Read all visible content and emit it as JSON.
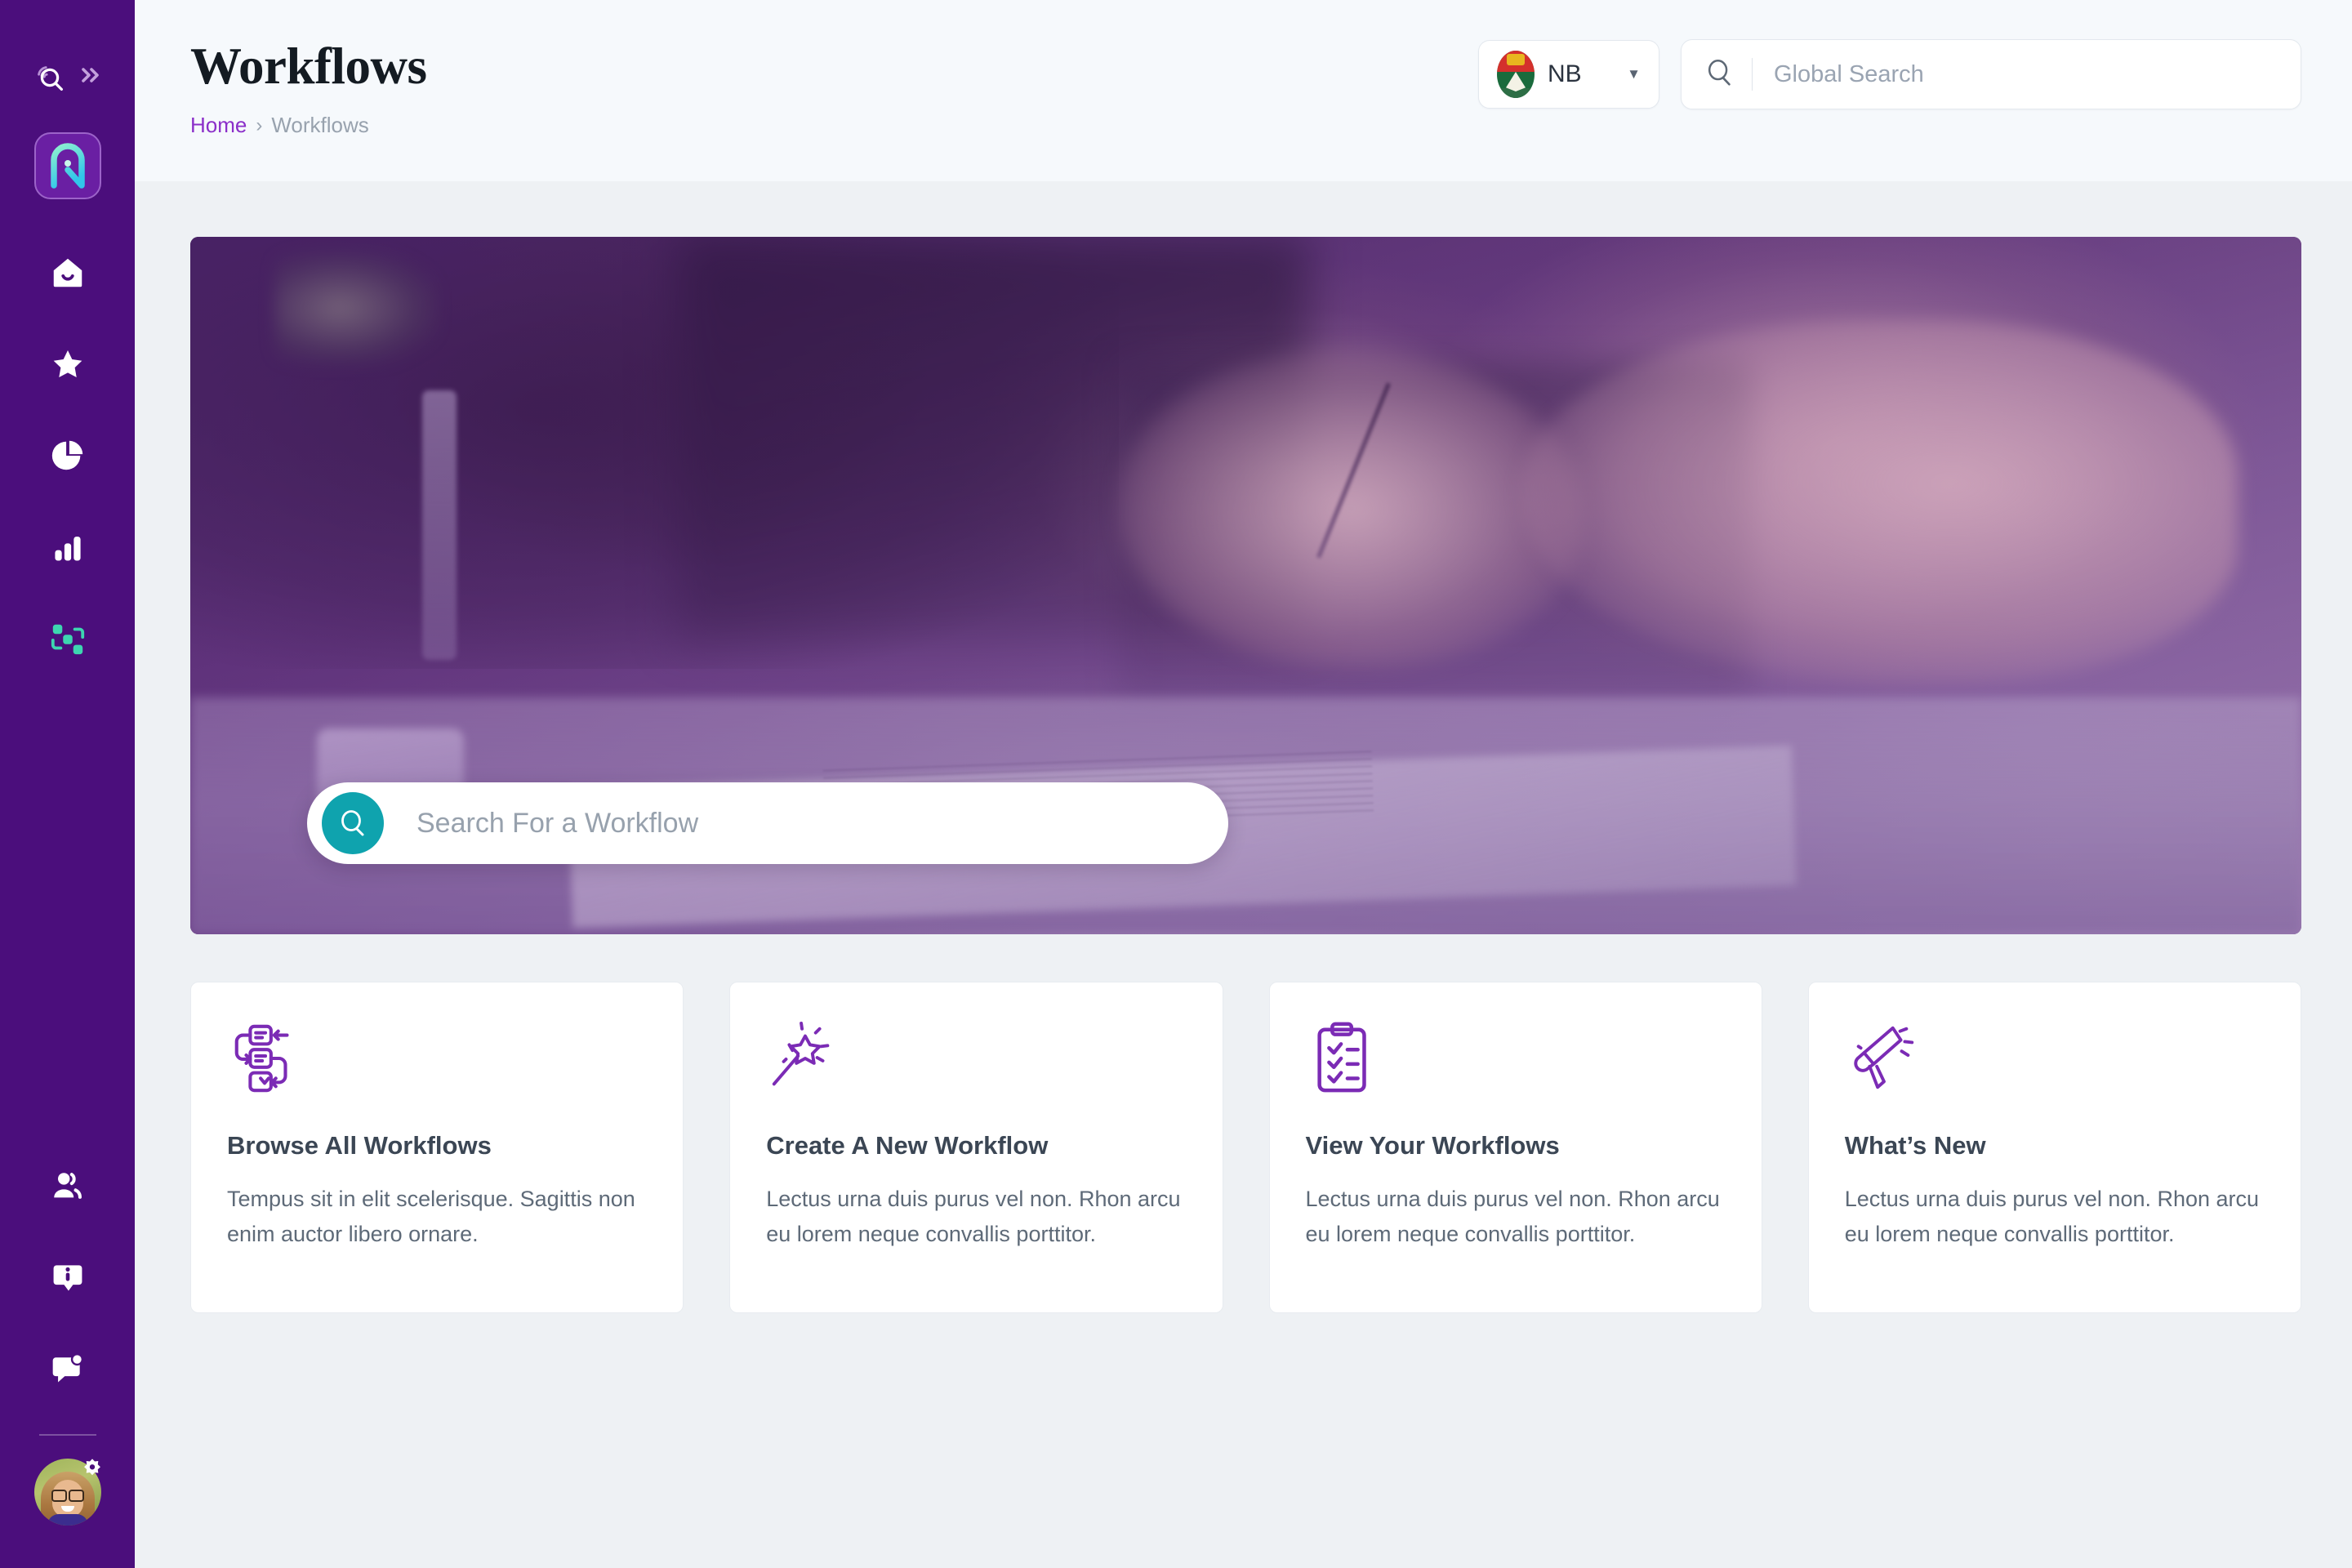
{
  "sidebar": {
    "search_icon": "search-signal-icon",
    "expand_icon": "double-chevron-right-icon",
    "logo_icon": "app-logo-icon",
    "items": [
      {
        "name": "home",
        "icon": "home-icon",
        "active": false
      },
      {
        "name": "favorites",
        "icon": "star-icon",
        "active": false
      },
      {
        "name": "reports",
        "icon": "pie-chart-icon",
        "active": false
      },
      {
        "name": "analytics",
        "icon": "bar-chart-icon",
        "active": false
      },
      {
        "name": "workflows",
        "icon": "workflow-nodes-icon",
        "active": true
      }
    ],
    "bottom_items": [
      {
        "name": "users",
        "icon": "users-icon"
      },
      {
        "name": "information",
        "icon": "info-bubble-icon"
      },
      {
        "name": "messages",
        "icon": "chat-bubble-icon"
      }
    ],
    "avatar": {
      "name": "user-avatar",
      "badge_icon": "gear-icon"
    },
    "background_color": "#4B0E7C",
    "accent_color": "#3DD6B0"
  },
  "header": {
    "title": "Workflows",
    "breadcrumb": {
      "home": "Home",
      "separator": "›",
      "current": "Workflows"
    },
    "region": {
      "code": "NB",
      "flag_icon": "new-brunswick-flag-icon",
      "caret_icon": "chevron-down-icon"
    },
    "global_search": {
      "placeholder": "Global Search",
      "value": "",
      "icon": "search-icon"
    }
  },
  "hero": {
    "image_alt": "business-people-signing-documents",
    "overlay_color": "#6B2F91",
    "search": {
      "placeholder": "Search For a Workflow",
      "value": "",
      "button_icon": "search-icon",
      "button_color": "#0FA3AE"
    }
  },
  "cards": [
    {
      "icon": "workflow-flowchart-icon",
      "title": "Browse All Workflows",
      "description": "Tempus sit in elit scelerisque. Sagittis non enim auctor libero ornare."
    },
    {
      "icon": "magic-wand-icon",
      "title": "Create A New Workflow",
      "description": "Lectus urna duis purus vel non. Rhon arcu eu lorem neque convallis porttitor."
    },
    {
      "icon": "clipboard-checklist-icon",
      "title": "View Your Workflows",
      "description": "Lectus urna duis purus vel non. Rhon arcu eu lorem neque convallis porttitor."
    },
    {
      "icon": "megaphone-icon",
      "title": "What’s New",
      "description": "Lectus urna duis purus vel non. Rhon arcu eu lorem neque convallis porttitor."
    }
  ],
  "theme": {
    "brand_purple": "#4B0E7C",
    "link_purple": "#8B2FC9",
    "icon_purple": "#7B2BB5",
    "teal": "#0FA3AE",
    "page_bg": "#EEF1F4",
    "header_bg": "#F6F9FC"
  }
}
